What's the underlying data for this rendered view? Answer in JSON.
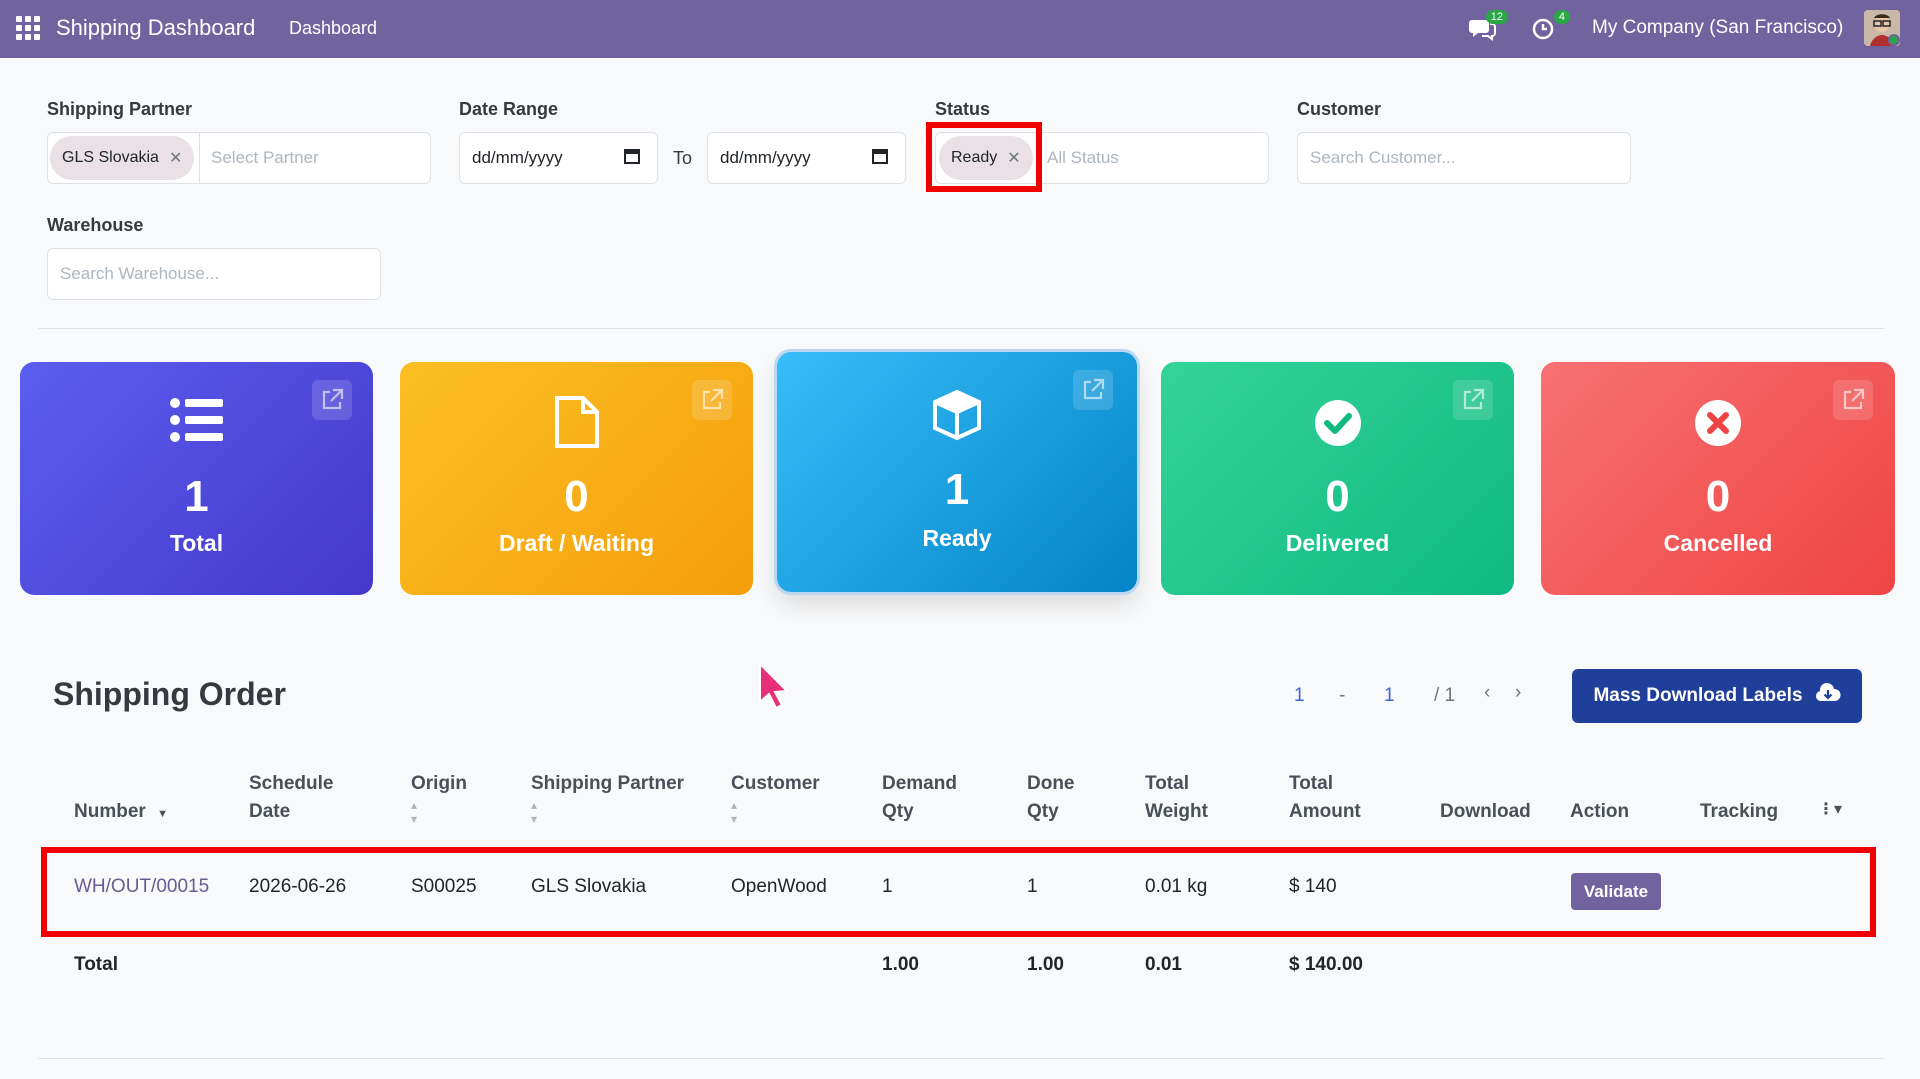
{
  "topbar": {
    "app_title": "Shipping Dashboard",
    "nav_dashboard": "Dashboard",
    "messages_badge": "12",
    "activities_badge": "4",
    "company": "My Company (San Francisco)"
  },
  "filters": {
    "partner_label": "Shipping Partner",
    "partner_tag": "GLS Slovakia",
    "partner_placeholder": "Select Partner",
    "date_label": "Date Range",
    "date_from": "dd/mm/yyyy",
    "date_to_label": "To",
    "date_to": "dd/mm/yyyy",
    "status_label": "Status",
    "status_tag": "Ready",
    "status_placeholder": "All Status",
    "customer_label": "Customer",
    "customer_placeholder": "Search Customer...",
    "warehouse_label": "Warehouse",
    "warehouse_placeholder": "Search Warehouse..."
  },
  "cards": [
    {
      "value": "1",
      "label": "Total",
      "color": "#4f46e5"
    },
    {
      "value": "0",
      "label": "Draft / Waiting",
      "color": "#f59e0b"
    },
    {
      "value": "1",
      "label": "Ready",
      "color": "#0ea5e9"
    },
    {
      "value": "0",
      "label": "Delivered",
      "color": "#10b981"
    },
    {
      "value": "0",
      "label": "Cancelled",
      "color": "#ef4444"
    }
  ],
  "orders": {
    "title": "Shipping Order",
    "pager": {
      "start": "1",
      "dash": "-",
      "end": "1",
      "total": "/ 1"
    },
    "mass_download": "Mass Download Labels",
    "columns": {
      "number": "Number",
      "schedule_1": "Schedule",
      "schedule_2": "Date",
      "origin": "Origin",
      "partner": "Shipping Partner",
      "customer": "Customer",
      "demand_1": "Demand",
      "demand_2": "Qty",
      "done_1": "Done",
      "done_2": "Qty",
      "weight_1": "Total",
      "weight_2": "Weight",
      "amount_1": "Total",
      "amount_2": "Amount",
      "download": "Download",
      "action": "Action",
      "tracking": "Tracking"
    },
    "row": {
      "number": "WH/OUT/00015",
      "date": "2026-06-26",
      "origin": "S00025",
      "partner": "GLS Slovakia",
      "customer": "OpenWood",
      "demand": "1",
      "done": "1",
      "weight": "0.01 kg",
      "amount": "$ 140",
      "action": "Validate"
    },
    "totals": {
      "label": "Total",
      "demand": "1.00",
      "done": "1.00",
      "weight": "0.01",
      "amount": "$ 140.00"
    }
  }
}
